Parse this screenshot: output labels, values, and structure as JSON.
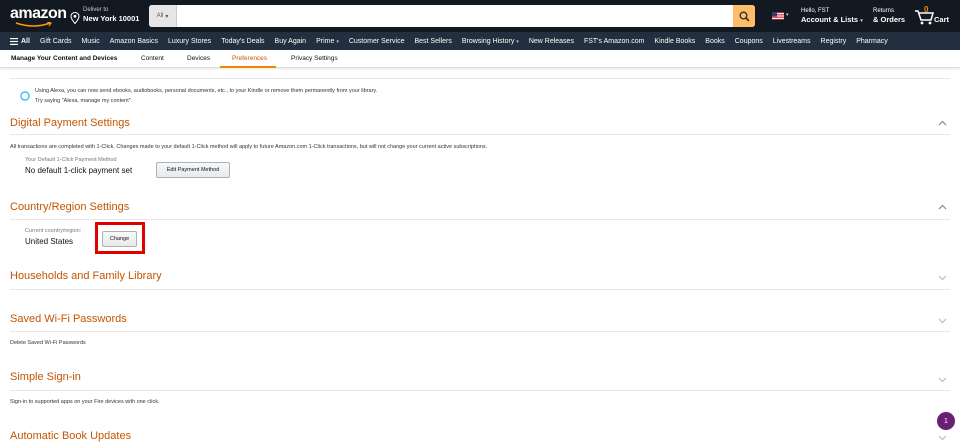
{
  "header": {
    "logo_text": "amazon",
    "deliver_small": "Deliver to",
    "deliver_location": "New York 10001",
    "search_category": "All",
    "search_placeholder": "",
    "greeting": "Hello, FST",
    "account_label": "Account & Lists",
    "returns_small": "Returns",
    "returns_label": "& Orders",
    "cart_count": "0",
    "cart_label": "Cart"
  },
  "nav": {
    "all_label": "All",
    "links": [
      "Gift Cards",
      "Music",
      "Amazon Basics",
      "Luxury Stores",
      "Today's Deals",
      "Buy Again",
      "Prime",
      "Customer Service",
      "Best Sellers",
      "Browsing History",
      "New Releases",
      "FST's Amazon.com",
      "Kindle Books",
      "Books",
      "Coupons",
      "Livestreams",
      "Registry",
      "Pharmacy"
    ]
  },
  "subnav": {
    "title": "Manage Your Content and Devices",
    "tabs": [
      "Content",
      "Devices",
      "Preferences",
      "Privacy Settings"
    ],
    "active_tab": "Preferences"
  },
  "alexa": {
    "line1": "Using Alexa, you can now send ebooks, audiobooks, personal documents, etc., to your Kindle or remove them permanently from your library.",
    "line2": "Try saying \"Alexa, manage my content\"."
  },
  "sections": {
    "digital_payment": {
      "title": "Digital Payment Settings",
      "description": "All transactions are completed with 1-Click. Changes made to your default 1-Click method will apply to future Amazon.com 1-Click transactions, but will not change your current active subscriptions.",
      "field_label": "Your Default 1-Click Payment Method",
      "field_value": "No default 1-click payment set",
      "button_label": "Edit Payment Method"
    },
    "country_region": {
      "title": "Country/Region Settings",
      "field_label": "Current country/region:",
      "field_value": "United States",
      "button_label": "Change"
    },
    "households": {
      "title": "Households and Family Library"
    },
    "wifi": {
      "title": "Saved Wi-Fi Passwords",
      "description": "Delete Saved Wi-Fi Passwords"
    },
    "sign_in": {
      "title": "Simple Sign-in",
      "description": "Sign-in to supported apps on your Fire devices with one click."
    },
    "book_updates": {
      "title": "Automatic Book Updates"
    }
  },
  "badge_count": "1",
  "colors": {
    "header_bg": "#131921",
    "nav_bg": "#232f3e",
    "section_title": "#c45500",
    "highlight": "#e00000",
    "search_button": "#febd69",
    "badge": "#6b1f74"
  }
}
